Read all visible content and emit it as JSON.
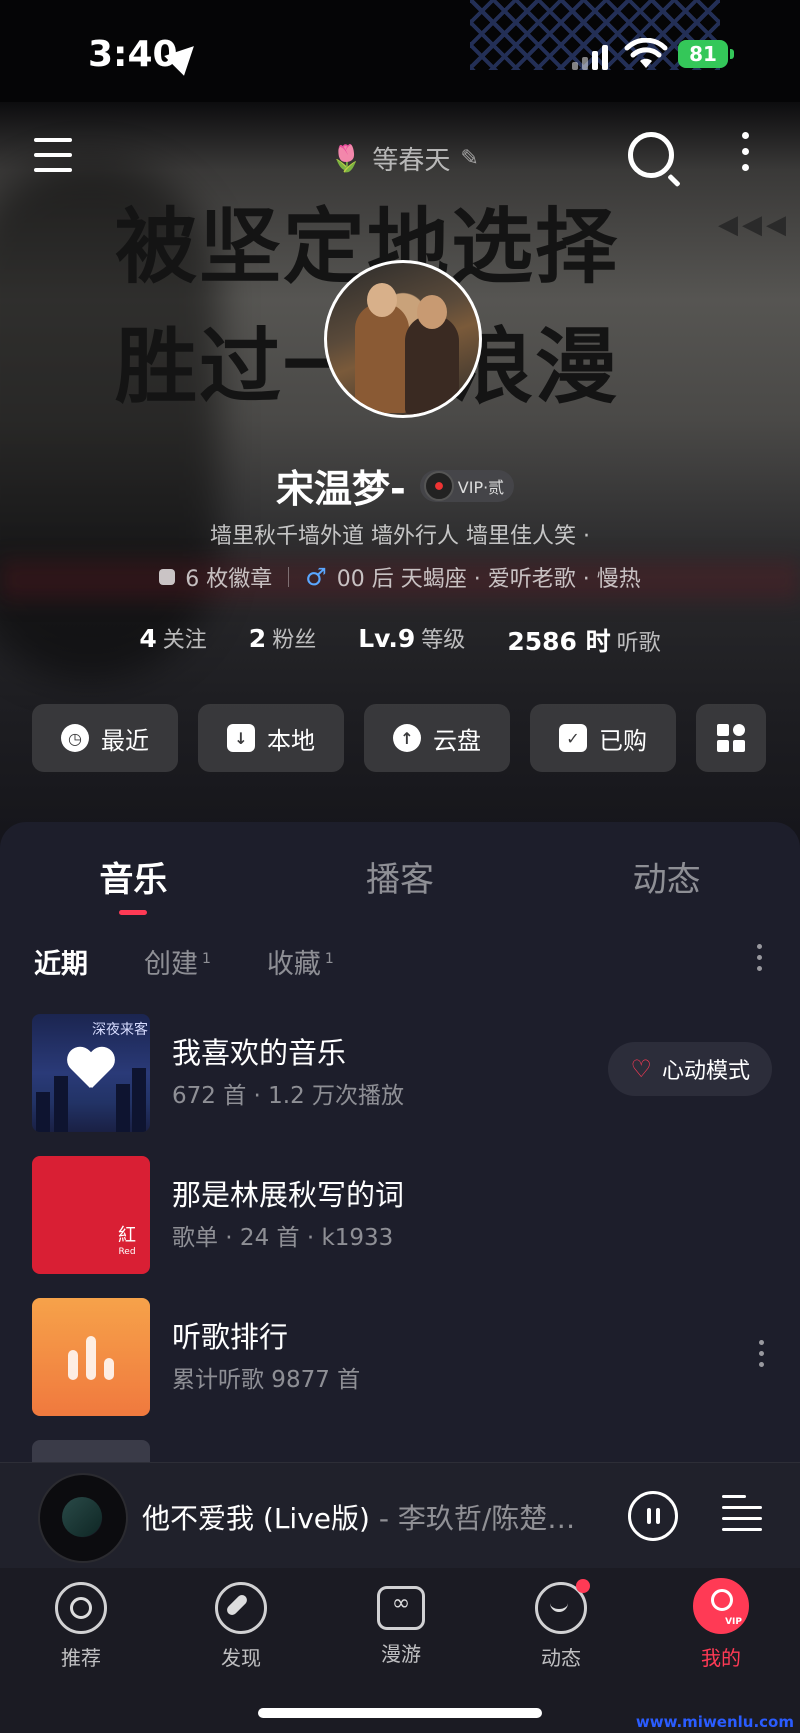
{
  "status_bar": {
    "time": "3:40",
    "battery": "81"
  },
  "header": {
    "nickname_top": "等春天"
  },
  "banner": {
    "line1": "被坚定地选择",
    "line2": "胜过一切浪漫"
  },
  "profile": {
    "name": "宋温梦-",
    "vip_label": "VIP·贰",
    "signature": "墙里秋千墙外道 墙外行人 墙里佳人笑 ·",
    "badges": "6 枚徽章",
    "tags": "00 后 天蝎座 · 爱听老歌 · 慢热",
    "stats": [
      {
        "value": "4",
        "label": "关注"
      },
      {
        "value": "2",
        "label": "粉丝"
      },
      {
        "value": "Lv.9",
        "label": "等级"
      },
      {
        "value": "2586 时",
        "label": "听歌"
      }
    ]
  },
  "quick_actions": [
    {
      "label": "最近",
      "icon": "clock-icon"
    },
    {
      "label": "本地",
      "icon": "download-icon"
    },
    {
      "label": "云盘",
      "icon": "cloud-upload-icon"
    },
    {
      "label": "已购",
      "icon": "bag-icon"
    }
  ],
  "main_tabs": [
    "音乐",
    "播客",
    "动态"
  ],
  "sub_tabs": [
    {
      "label": "近期",
      "count": ""
    },
    {
      "label": "创建",
      "count": "1"
    },
    {
      "label": "收藏",
      "count": "1"
    }
  ],
  "playlists": [
    {
      "title": "我喜欢的音乐",
      "sub": "672 首 · 1.2 万次播放",
      "action": "心动模式",
      "cover_text": "深夜来客"
    },
    {
      "title": "那是林展秋写的词",
      "sub": "歌单 · 24 首 · k1933",
      "cover_text": "紅",
      "cover_subtext": "Red"
    },
    {
      "title": "听歌排行",
      "sub": "累计听歌 9877 首"
    }
  ],
  "player": {
    "title": "他不爱我 (Live版)",
    "artist": "- 李玖哲/陈楚…"
  },
  "bottom_nav": [
    {
      "label": "推荐",
      "icon": "recommend-icon"
    },
    {
      "label": "发现",
      "icon": "compass-icon"
    },
    {
      "label": "漫游",
      "icon": "radio-icon"
    },
    {
      "label": "动态",
      "icon": "feed-icon"
    },
    {
      "label": "我的",
      "icon": "profile-vip-icon"
    }
  ],
  "watermark": "www.miwenlu.com",
  "colors": {
    "accent": "#ff3a55",
    "panel": "#1d1e2b",
    "battery": "#34c759"
  }
}
